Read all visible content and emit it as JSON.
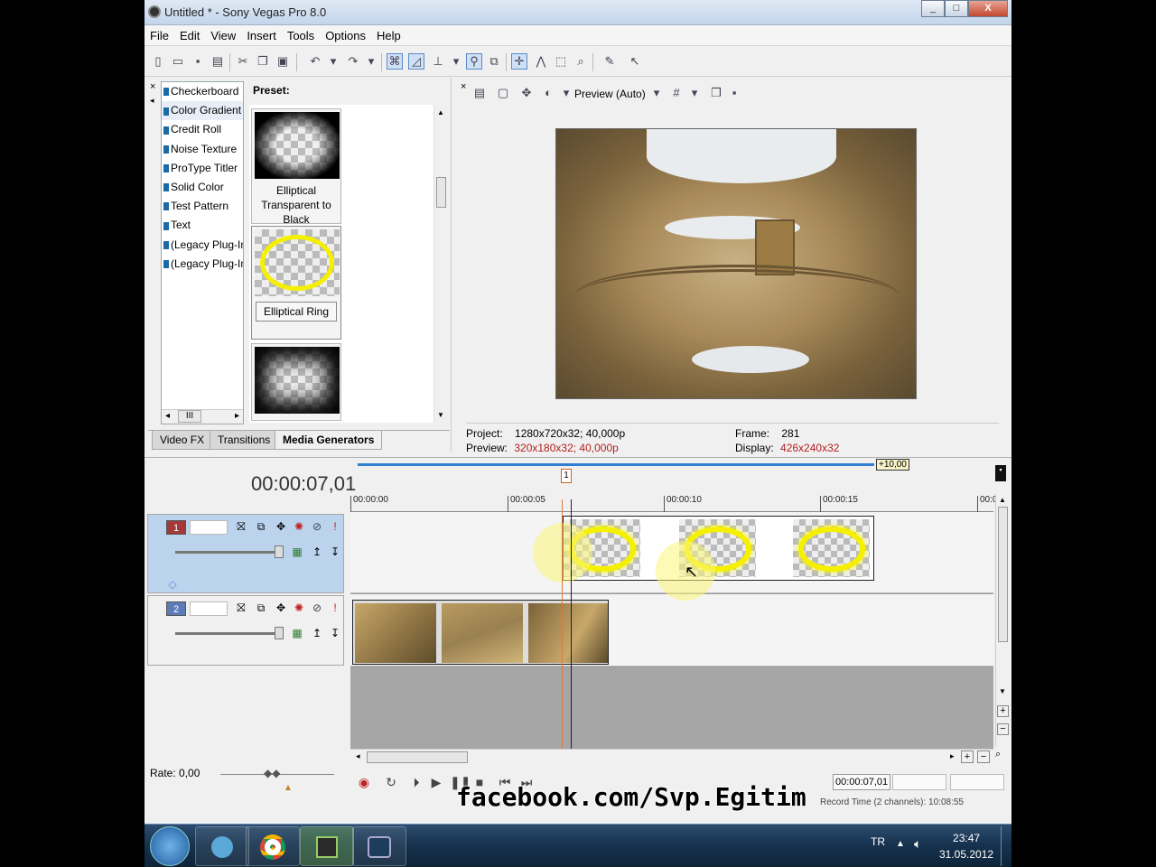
{
  "window": {
    "title": "Untitled * - Sony Vegas Pro 8.0",
    "min": "_",
    "max": "□",
    "close": "X"
  },
  "menu": [
    "File",
    "Edit",
    "View",
    "Insert",
    "Tools",
    "Options",
    "Help"
  ],
  "generators": {
    "items": [
      "Checkerboard",
      "Color Gradient",
      "Credit Roll",
      "Noise Texture",
      "ProType Titler",
      "Solid Color",
      "Test Pattern",
      "Text",
      "(Legacy Plug-In) T",
      "(Legacy Plug-In) V"
    ],
    "scroll_label": "III"
  },
  "preset": {
    "label": "Preset:",
    "items": [
      {
        "caption": "Elliptical Transparent to Black"
      },
      {
        "caption": "Elliptical Ring"
      },
      {
        "caption": ""
      }
    ]
  },
  "tabs": [
    "Video FX",
    "Transitions",
    "Media Generators"
  ],
  "active_tab": "Media Generators",
  "preview": {
    "mode": "Preview (Auto)",
    "project_label": "Project:",
    "project_value": "1280x720x32; 40,000p",
    "preview_label": "Preview:",
    "preview_value": "320x180x32; 40,000p",
    "frame_label": "Frame:",
    "frame_value": "281",
    "display_label": "Display:",
    "display_value": "426x240x32"
  },
  "timeline": {
    "timecode": "00:00:07,01",
    "loop_badge": "+10,00",
    "marker": "1",
    "ruler": [
      "00:00:00",
      "00:00:05",
      "00:00:10",
      "00:00:15",
      "00:0"
    ],
    "tracks": [
      {
        "number": "1",
        "color": "#a23a3a"
      },
      {
        "number": "2",
        "color": "#5a7ab8"
      }
    ],
    "rate": "Rate: 0,00",
    "transport_time": "00:00:07,01",
    "status": "Record Time (2 channels): 10:08:55"
  },
  "watermark": "facebook.com/Svp.Egitim",
  "taskbar": {
    "lang": "TR",
    "time": "23:47",
    "date": "31.05.2012"
  },
  "colors": {
    "accent": "#5a8bc8",
    "track1": "#a23a3a",
    "track2": "#5a7ab8",
    "ring": "#f5f000"
  }
}
